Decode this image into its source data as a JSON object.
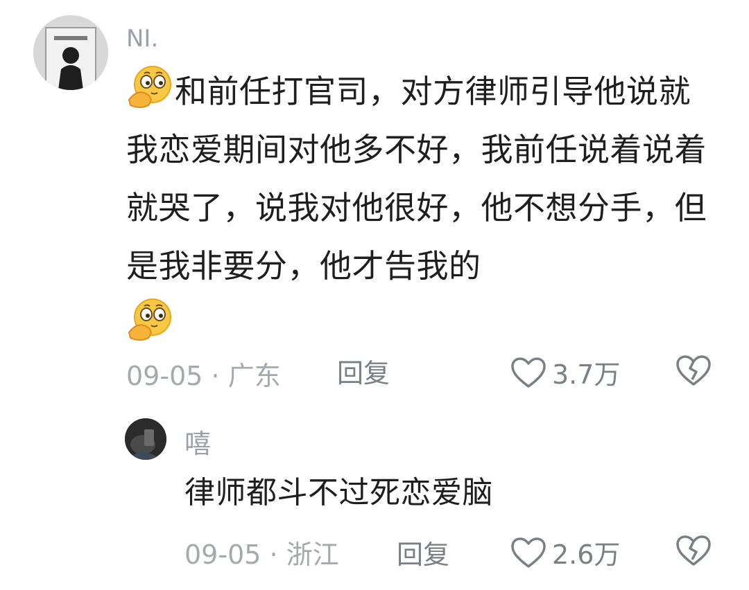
{
  "comments": [
    {
      "username": "NI.",
      "text": "和前任打官司，对方律师引导他说就我恋爱期间对他多不好，我前任说着说着就哭了，说我对他很好，他不想分手，但是我非要分，他才告我的",
      "date": "09-05",
      "separator": "·",
      "location": "广东",
      "reply_label": "回复",
      "likes": "3.7万",
      "icons": {
        "like": "heart-outline-icon",
        "dislike": "broken-heart-icon",
        "emoji": "thinking-face-emoji"
      }
    },
    {
      "username": "嘻",
      "text": "律师都斗不过死恋爱脑",
      "date": "09-05",
      "separator": "·",
      "location": "浙江",
      "reply_label": "回复",
      "likes": "2.6万",
      "icons": {
        "like": "heart-outline-icon",
        "dislike": "broken-heart-icon"
      }
    }
  ],
  "colors": {
    "text_primary": "#1e1e1e",
    "text_secondary": "#a5a9ad",
    "text_action": "#7a7f84",
    "background": "#ffffff"
  }
}
